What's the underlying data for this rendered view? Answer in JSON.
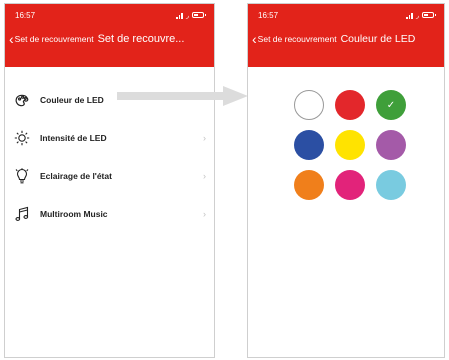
{
  "left_screen": {
    "status": {
      "time": "16:57"
    },
    "nav": {
      "back_label": "Set de recouvrement",
      "title": "Set de recouvre..."
    },
    "menu_items": [
      {
        "label": "Couleur de LED",
        "icon": "led-color-icon"
      },
      {
        "label": "Intensité de LED",
        "icon": "sun-icon"
      },
      {
        "label": "Eclairage de l'état",
        "icon": "bulb-icon"
      },
      {
        "label": "Multiroom Music",
        "icon": "music-note-icon"
      }
    ]
  },
  "right_screen": {
    "status": {
      "time": "16:57"
    },
    "nav": {
      "back_label": "Set de recouvrement",
      "title": "Couleur de LED"
    },
    "colors": [
      "#ffffff",
      "#e3272b",
      "#3f9f3a",
      "#2b4fa3",
      "#ffe300",
      "#a45aa8",
      "#f07f1b",
      "#e2237a",
      "#79cbe0"
    ],
    "selected_color": "#3f9f3a"
  },
  "theme": {
    "accent": "#e2231a"
  }
}
